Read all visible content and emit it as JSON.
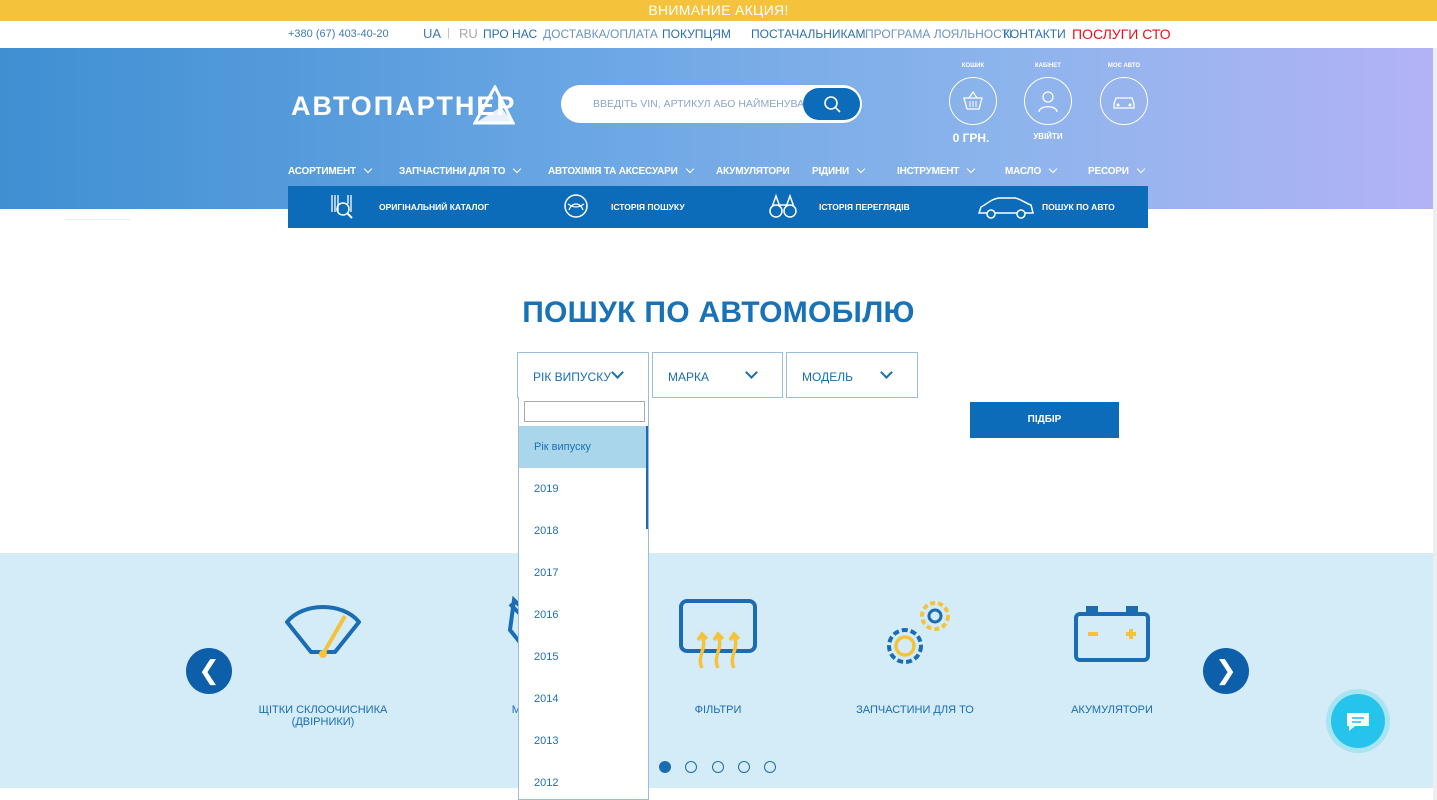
{
  "promo": {
    "text": "ВНИМАНИЕ АКЦИЯ!"
  },
  "topbar": {
    "phone": "+380 (67) 403-40-20",
    "lang_ua": "UA",
    "lang_sep": "|",
    "lang_ru": "RU",
    "links": [
      "ПРО НАС",
      "ДОСТАВКА/ОПЛАТА",
      "ПОКУПЦЯМ",
      "ПОСТАЧАЛЬНИКАМ",
      "ПРОГРАМА ЛОЯЛЬНОСТІ",
      "КОНТАКТИ",
      "ПОСЛУГИ СТО"
    ]
  },
  "header": {
    "logo_text": "АВТОПАРТНЕР",
    "search_placeholder": "ВВЕДІТЬ VIN, АРТИКУЛ АБО НАЙМЕНУВАННЯ",
    "cart_label": "КОШИК",
    "cabinet_label": "КАБІНЕТ",
    "mycar_label": "МОЄ АВТО",
    "cart_sum": "0 ГРН.",
    "login": "УВІЙТИ"
  },
  "menu": [
    "АСОРТИМЕНТ",
    "ЗАПЧАСТИНИ ДЛЯ ТО",
    "АВТОХІМІЯ ТА АКСЕСУАРИ",
    "АКУМУЛЯТОРИ",
    "РІДИНИ",
    "ІНСТРУМЕНТ",
    "МАСЛО",
    "РЕСОРИ"
  ],
  "subnav": [
    "ОРИГІНАЛЬНИЙ КАТАЛОГ",
    "ІСТОРІЯ ПОШУКУ",
    "ІСТОРІЯ ПЕРЕГЛЯДІВ",
    "ПОШУК ПО АВТО"
  ],
  "search_car": {
    "title": "ПОШУК ПО АВТОМОБІЛЮ",
    "year_label": "РІК ВИПУСКУ",
    "brand_label": "МАРКА",
    "model_label": "МОДЕЛЬ",
    "pick_button": "ПІДБІР",
    "filter_value": "",
    "year_options": [
      "Рік випуску",
      "2019",
      "2018",
      "2017",
      "2016",
      "2015",
      "2014",
      "2013",
      "2012"
    ]
  },
  "categories": [
    {
      "label": "ЩІТКИ СКЛООЧИСНИКА (ДВІРНИКИ)",
      "icon": "wiper-icon"
    },
    {
      "label": "МА",
      "icon": "oil-can-icon"
    },
    {
      "label": "ФІЛЬТРИ",
      "icon": "filter-icon"
    },
    {
      "label": "ЗАПЧАСТИНИ ДЛЯ ТО",
      "icon": "gears-icon"
    },
    {
      "label": "АКУМУЛЯТОРИ",
      "icon": "battery-icon"
    }
  ],
  "carousel": {
    "prev": "❮",
    "next": "❯",
    "pages": 5,
    "active_page": 1
  },
  "colors": {
    "promo": "#f5c33b",
    "primary": "#0c6cb9",
    "accent_red": "#e8131a",
    "band": "#d4ebf8",
    "chat": "#26c4ec"
  }
}
